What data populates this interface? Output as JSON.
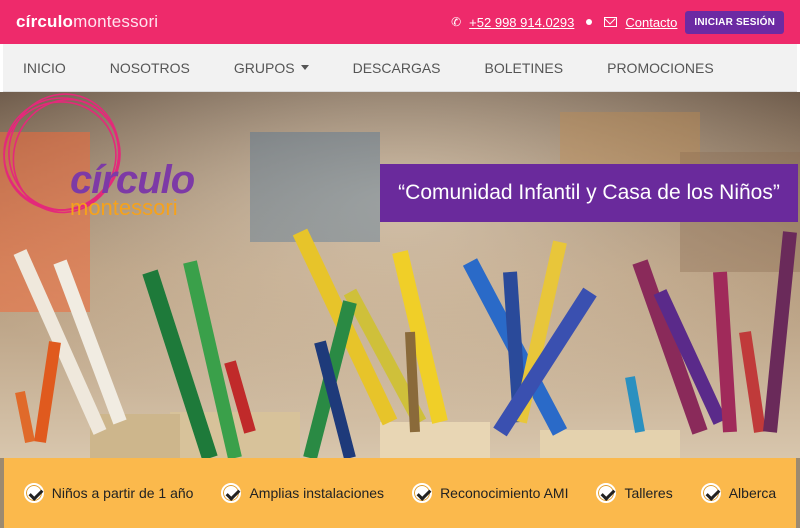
{
  "header": {
    "brand_bold": "círculo",
    "brand_light": "montessori",
    "phone": "+52 998 914.0293",
    "contact_label": "Contacto",
    "login_label": "INICIAR SESIÓN"
  },
  "nav": {
    "items": [
      {
        "label": "INICIO"
      },
      {
        "label": "NOSOTROS"
      },
      {
        "label": "GRUPOS"
      },
      {
        "label": "DESCARGAS"
      },
      {
        "label": "BOLETINES"
      },
      {
        "label": "PROMOCIONES"
      }
    ]
  },
  "hero": {
    "logo_word1": "círculo",
    "logo_word2": "montessori",
    "tagline": "“Comunidad Infantil y Casa de los Niños”"
  },
  "features": [
    {
      "label": "Niños a partir de 1 año",
      "icon": "check-icon"
    },
    {
      "label": "Amplias instalaciones",
      "icon": "check-icon"
    },
    {
      "label": "Reconocimiento AMI",
      "icon": "check-icon"
    },
    {
      "label": "Talleres",
      "icon": "check-icon"
    },
    {
      "label": "Alberca",
      "icon": "check-icon"
    }
  ],
  "colors": {
    "brand_pink": "#ee2a6b",
    "brand_purple": "#6a2a9c",
    "brand_orange": "#fbb94c"
  }
}
